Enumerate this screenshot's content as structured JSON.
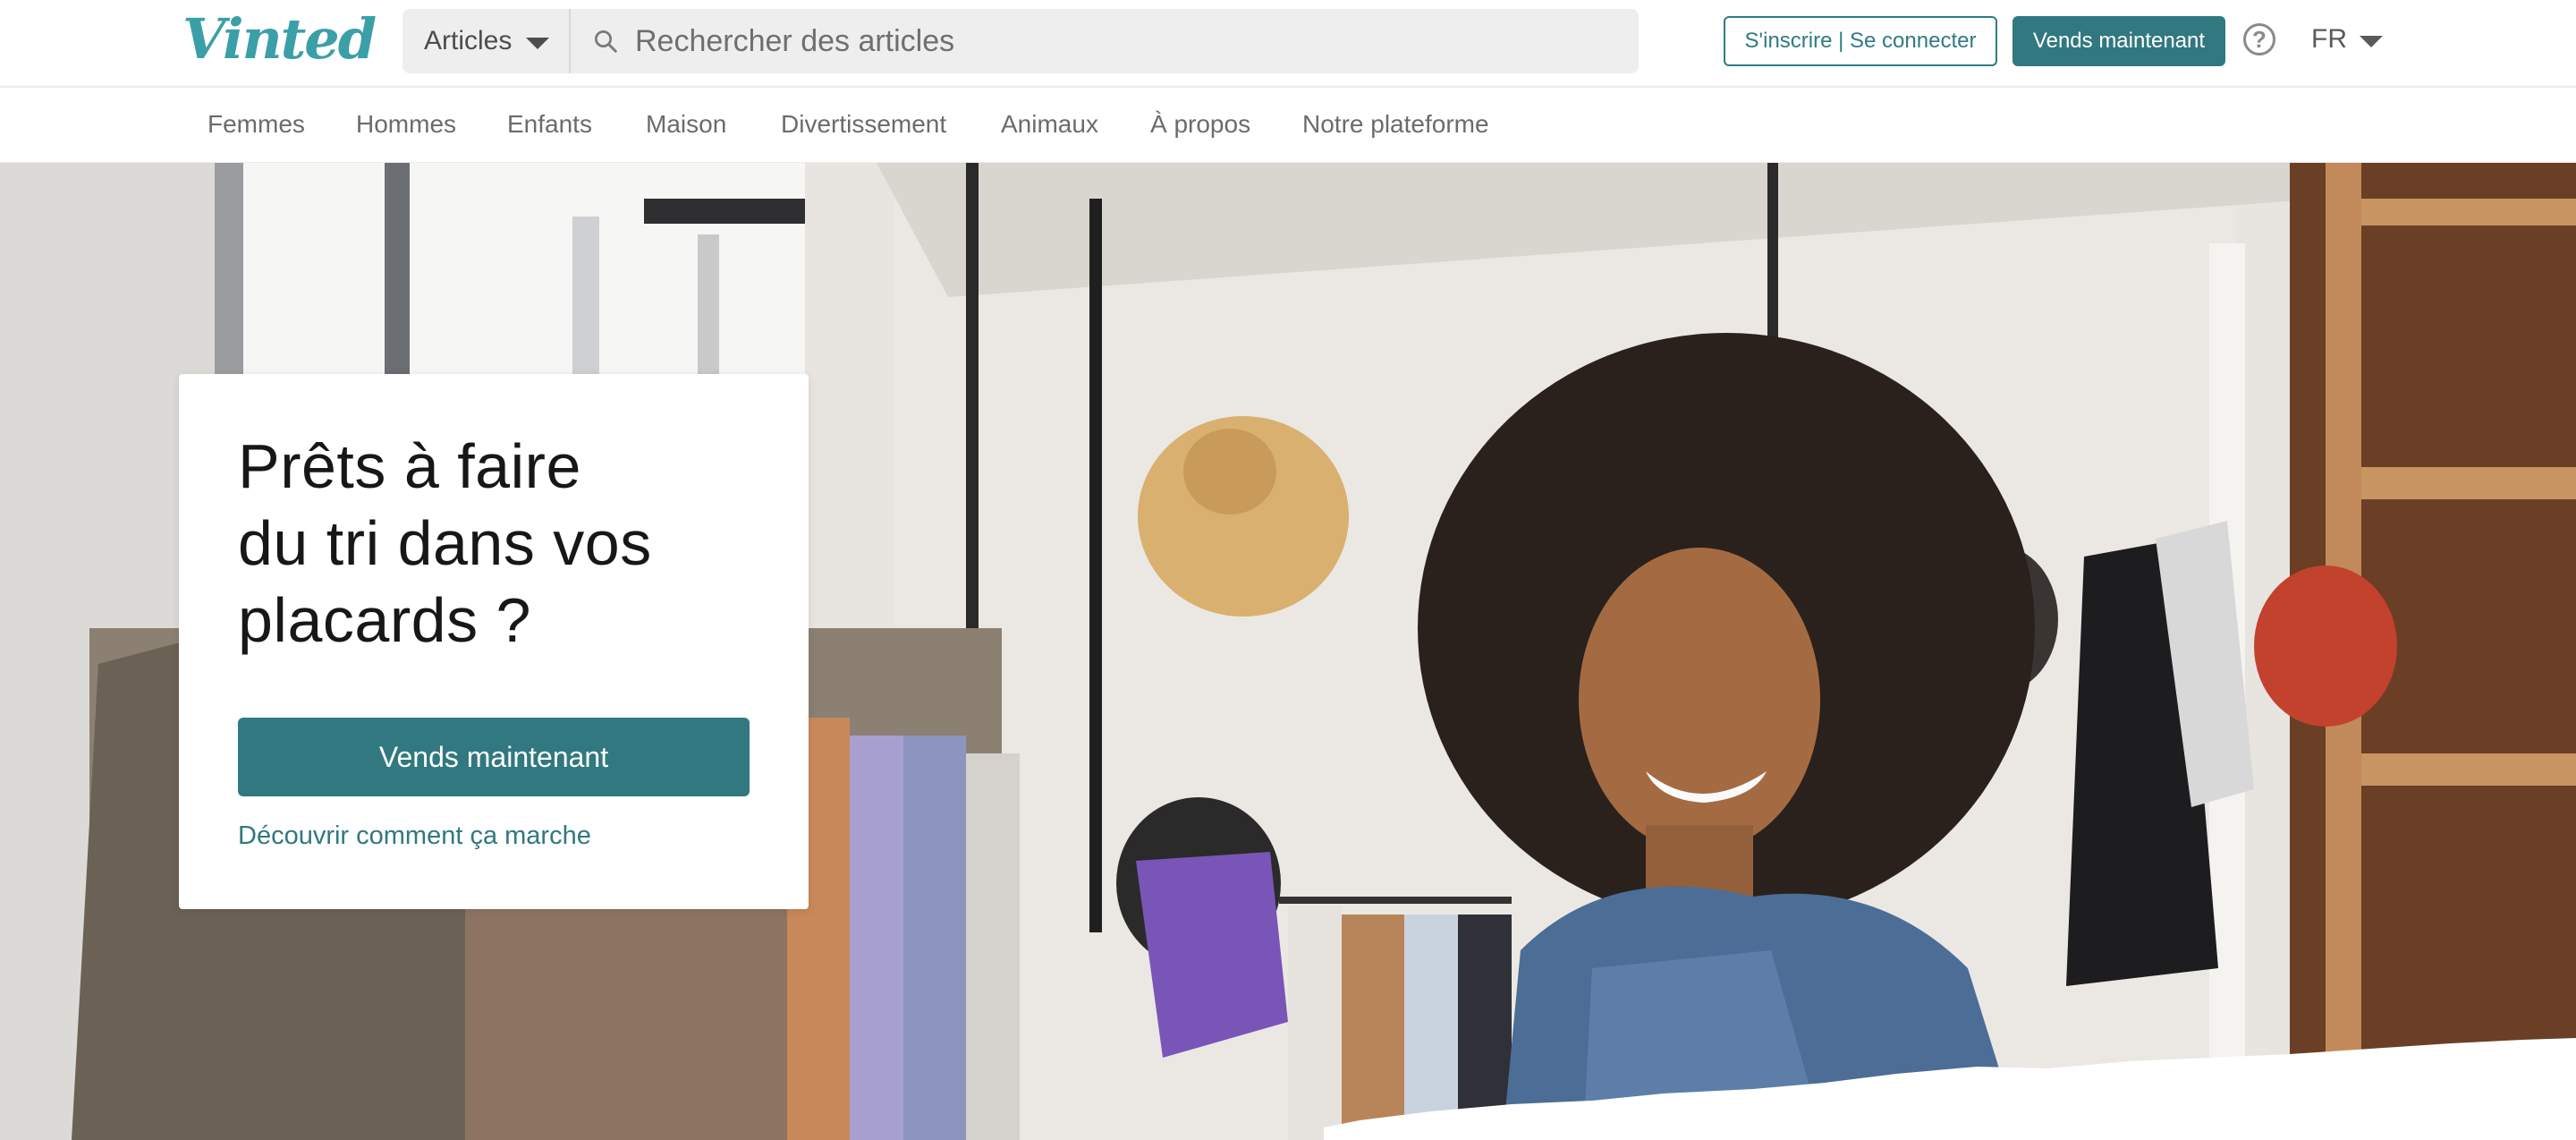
{
  "brand": {
    "logo_text": "Vinted",
    "accent": "#317880",
    "logo_color": "#3b9fa8"
  },
  "search": {
    "category_label": "Articles",
    "placeholder": "Rechercher des articles",
    "value": ""
  },
  "header": {
    "signin_label": "S'inscrire | Se connecter",
    "sell_label": "Vends maintenant",
    "help_glyph": "?",
    "language": "FR"
  },
  "nav": {
    "items": [
      "Femmes",
      "Hommes",
      "Enfants",
      "Maison",
      "Divertissement",
      "Animaux",
      "À propos",
      "Notre plateforme"
    ]
  },
  "hero": {
    "headline_lines": [
      "Prêts à faire",
      "du tri dans vos",
      "placards ?"
    ],
    "cta_label": "Vends maintenant",
    "link_label": "Découvrir comment ça marche"
  },
  "icons": {
    "search": "search-icon",
    "help": "help-icon",
    "dropdown": "chevron-down-icon"
  }
}
